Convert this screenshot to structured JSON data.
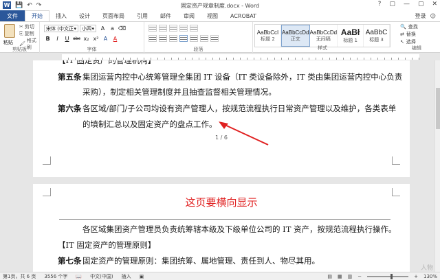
{
  "window": {
    "title": "固定资产规章制度.docx - Word",
    "qat_icons": [
      "save-icon",
      "undo-icon",
      "redo-icon"
    ],
    "buttons": [
      "?",
      "▢",
      "—",
      "▢",
      "✕"
    ]
  },
  "tabs": [
    {
      "label": "文件"
    },
    {
      "label": "开始"
    },
    {
      "label": "插入"
    },
    {
      "label": "设计"
    },
    {
      "label": "页面布局"
    },
    {
      "label": "引用"
    },
    {
      "label": "邮件"
    },
    {
      "label": "审阅"
    },
    {
      "label": "视图"
    },
    {
      "label": "ACROBAT"
    }
  ],
  "signin": "登录",
  "ribbon": {
    "clipboard": {
      "paste": "粘贴",
      "cut": "剪切",
      "copy": "复制",
      "format_painter": "格式刷",
      "label": "剪贴板"
    },
    "font": {
      "name": "宋体 (中文正",
      "size": "小四",
      "label": "字体",
      "buttons": [
        "B",
        "I",
        "U",
        "abc",
        "x₂",
        "x²",
        "A",
        "A"
      ]
    },
    "paragraph": {
      "label": "段落"
    },
    "styles": {
      "label": "样式",
      "items": [
        {
          "sample": "AaBbCcI",
          "name": "标题 2"
        },
        {
          "sample": "AaBbCcDd",
          "name": "正文"
        },
        {
          "sample": "AaBbCcDd",
          "name": "无间隔"
        },
        {
          "sample": "AaBł",
          "name": "标题 1"
        },
        {
          "sample": "AaBbC",
          "name": "标题 3"
        }
      ]
    },
    "editing": {
      "find": "查找",
      "replace": "替换",
      "select": "选择",
      "label": "编辑"
    }
  },
  "document": {
    "page1": {
      "cut_top": "【IT 固定资产的管理机构】",
      "art5_label": "第五条",
      "art5_line1": "集团运营内控中心统筹管理全集团 IT 设备（IT 类设备除外，IT 类由集团运营内控中心负责",
      "art5_line2": "采购），制定相关管理制度并且抽查监督相关管理情况。",
      "art6_label": "第六条",
      "art6_line1": "各区域/部门/子公司均设有资产管理人，按规范流程执行日常资产管理以及维护，各类表单",
      "art6_line2": "的填制汇总以及固定资产的盘点工作。",
      "page_number": "1 / 6"
    },
    "page2": {
      "header_title": "这页要横向显示",
      "para1": "各区域集团资产管理员负责统筹辖本级及下级单位公司的 IT 资产，按规范流程执行操作。",
      "heading": "【IT 固定资产的管理原则】",
      "art7_label": "第七条",
      "art7_text": "固定资产的管理原则：集团统筹、属地管理、责任到人、物尽其用。"
    }
  },
  "status": {
    "page": "第1页，共 6 页",
    "words": "3556 个字",
    "lang": "中文(中国)",
    "mode": "插入",
    "zoom": "130%"
  },
  "watermark": "人物",
  "colors": {
    "accent": "#2b579a",
    "annotation": "#e02020"
  }
}
